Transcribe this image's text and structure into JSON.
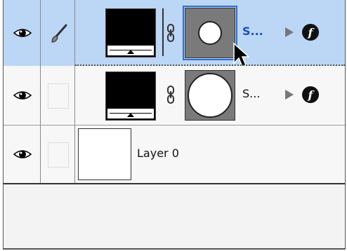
{
  "layers": [
    {
      "name": "S...",
      "visible": true,
      "brush_linked": true,
      "selected": true,
      "has_layer_mask": true,
      "mask_active": true,
      "effects_icon": "fx-icon"
    },
    {
      "name": "S...",
      "visible": true,
      "brush_linked": false,
      "selected": false,
      "has_layer_mask": true,
      "mask_active": false,
      "effects_icon": "fx-icon"
    },
    {
      "name": "Layer 0",
      "visible": true,
      "brush_linked": false,
      "selected": false,
      "has_layer_mask": false
    }
  ],
  "colors": {
    "selected_row": "#bcd6f5",
    "selected_text": "#1a4fb5",
    "mask_gray": "#7a7a7a"
  }
}
